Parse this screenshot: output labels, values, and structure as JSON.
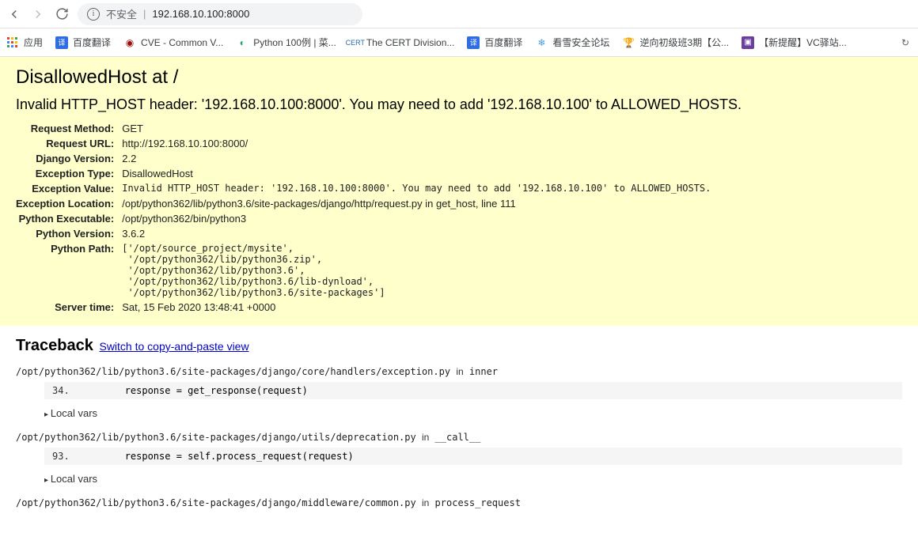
{
  "chrome": {
    "insecure_label": "不安全",
    "url": "192.168.10.100:8000"
  },
  "bookmarks": {
    "apps": "应用",
    "items": [
      {
        "label": "百度翻译",
        "icon_color": "#2f6ee2",
        "icon": "译"
      },
      {
        "label": "CVE - Common V...",
        "icon_color": "#9a0b0b",
        "icon": "●"
      },
      {
        "label": "Python 100例 | 菜...",
        "icon_color": "#1fa463",
        "icon": "◐"
      },
      {
        "label": "The CERT Division...",
        "icon_color": "#2b6cb0",
        "icon": "◆"
      },
      {
        "label": "百度翻译",
        "icon_color": "#2f6ee2",
        "icon": "译"
      },
      {
        "label": "看雪安全论坛",
        "icon_color": "#4aa3df",
        "icon": "❄"
      },
      {
        "label": "逆向初级班3期【公...",
        "icon_color": "#e2a23b",
        "icon": "🏆"
      },
      {
        "label": "【新提醒】VC驿站...",
        "icon_color": "#6b3fa0",
        "icon": "◘"
      }
    ],
    "overflow": "↻"
  },
  "error": {
    "title": "DisallowedHost at /",
    "subtitle": "Invalid HTTP_HOST header: '192.168.10.100:8000'. You may need to add '192.168.10.100' to ALLOWED_HOSTS.",
    "rows": {
      "request_method": {
        "label": "Request Method:",
        "value": "GET"
      },
      "request_url": {
        "label": "Request URL:",
        "value": "http://192.168.10.100:8000/"
      },
      "django_version": {
        "label": "Django Version:",
        "value": "2.2"
      },
      "exception_type": {
        "label": "Exception Type:",
        "value": "DisallowedHost"
      },
      "exception_value": {
        "label": "Exception Value:",
        "value": "Invalid HTTP_HOST header: '192.168.10.100:8000'. You may need to add '192.168.10.100' to ALLOWED_HOSTS."
      },
      "exception_location": {
        "label": "Exception Location:",
        "value": "/opt/python362/lib/python3.6/site-packages/django/http/request.py in get_host, line 111"
      },
      "python_executable": {
        "label": "Python Executable:",
        "value": "/opt/python362/bin/python3"
      },
      "python_version": {
        "label": "Python Version:",
        "value": "3.6.2"
      },
      "python_path": {
        "label": "Python Path:",
        "value": "['/opt/source_project/mysite',\n '/opt/python362/lib/python36.zip',\n '/opt/python362/lib/python3.6',\n '/opt/python362/lib/python3.6/lib-dynload',\n '/opt/python362/lib/python3.6/site-packages']"
      },
      "server_time": {
        "label": "Server time:",
        "value": "Sat, 15 Feb 2020 13:48:41 +0000"
      }
    }
  },
  "traceback": {
    "heading": "Traceback",
    "switch_link": "Switch to copy-and-paste view",
    "local_vars": "Local vars",
    "frames": [
      {
        "path": "/opt/python362/lib/python3.6/site-packages/django/core/handlers/exception.py",
        "in_word": "in",
        "func": "inner",
        "line_no": "34.",
        "code": "response = get_response(request)"
      },
      {
        "path": "/opt/python362/lib/python3.6/site-packages/django/utils/deprecation.py",
        "in_word": "in",
        "func": "__call__",
        "line_no": "93.",
        "code": "response = self.process_request(request)"
      },
      {
        "path": "/opt/python362/lib/python3.6/site-packages/django/middleware/common.py",
        "in_word": "in",
        "func": "process_request",
        "line_no": "",
        "code": ""
      }
    ]
  }
}
